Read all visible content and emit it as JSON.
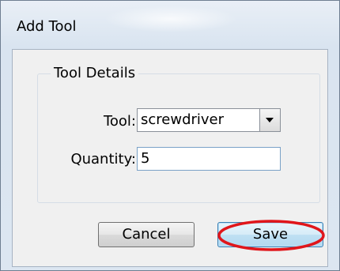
{
  "window": {
    "title": "Add Tool"
  },
  "group": {
    "legend": "Tool Details"
  },
  "fields": {
    "tool_label": "Tool:",
    "tool_value": "screwdriver",
    "quantity_label": "Quantity:",
    "quantity_value": "5"
  },
  "buttons": {
    "cancel_label": "Cancel",
    "save_label": "Save"
  },
  "icons": {
    "dropdown": "chevron-down-icon"
  },
  "colors": {
    "highlight_ring": "#e0161b",
    "save_border": "#3c7fb1"
  }
}
